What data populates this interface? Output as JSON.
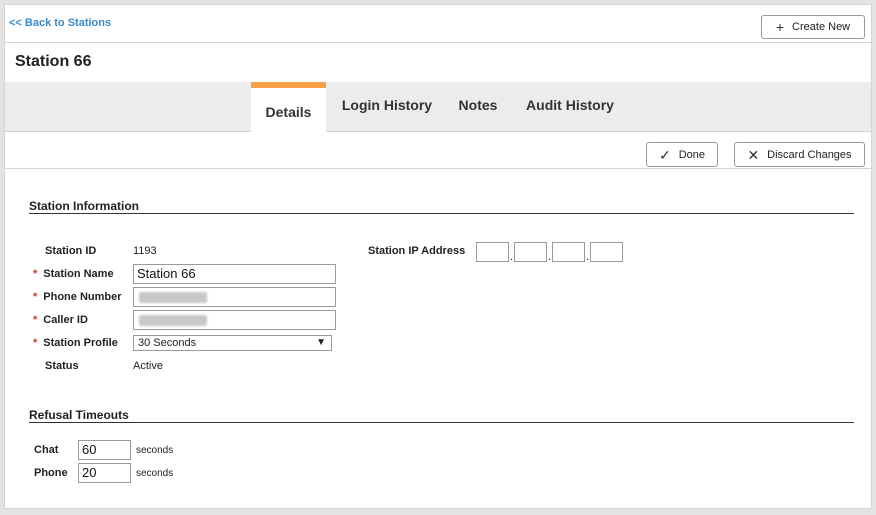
{
  "header": {
    "back_label": "<< Back to Stations",
    "create_label": "Create New",
    "title": "Station 66"
  },
  "tabs": [
    {
      "label": "Details",
      "active": true
    },
    {
      "label": "Login History",
      "active": false
    },
    {
      "label": "Notes",
      "active": false
    },
    {
      "label": "Audit History",
      "active": false
    }
  ],
  "actions": {
    "done_label": "Done",
    "discard_label": "Discard Changes"
  },
  "station_info": {
    "section_title": "Station Information",
    "station_id_label": "Station ID",
    "station_id_value": "1193",
    "station_name_label": "Station Name",
    "station_name_value": "Station 66",
    "phone_number_label": "Phone Number",
    "caller_id_label": "Caller ID",
    "station_profile_label": "Station Profile",
    "station_profile_value": "30 Seconds",
    "status_label": "Status",
    "status_value": "Active",
    "ip_label": "Station IP Address",
    "required_marker": "*"
  },
  "refusal": {
    "section_title": "Refusal Timeouts",
    "chat_label": "Chat",
    "chat_value": "60",
    "phone_label": "Phone",
    "phone_value": "20",
    "unit": "seconds"
  },
  "colors": {
    "accent_tab": "#f7a048",
    "link": "#3a89c9",
    "required": "#d9312b"
  }
}
